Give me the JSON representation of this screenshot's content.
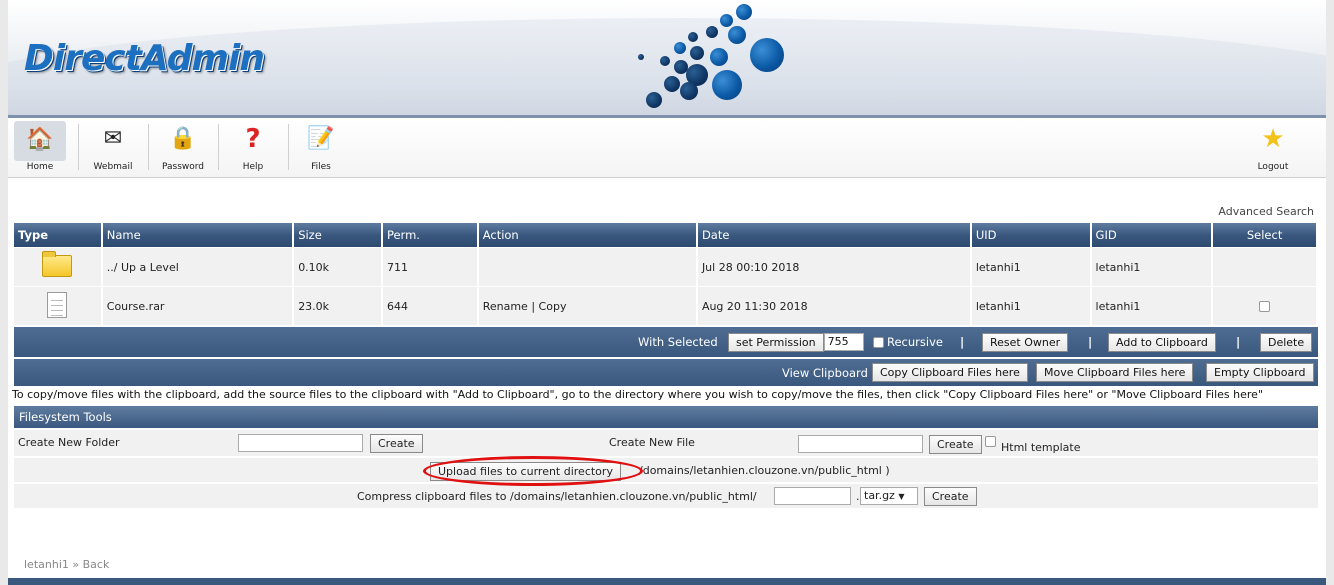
{
  "brand": {
    "logo_text": "DirectAdmin"
  },
  "toolbar": {
    "items": [
      {
        "label": "Home",
        "icon": "home-icon"
      },
      {
        "label": "Webmail",
        "icon": "mail-icon"
      },
      {
        "label": "Password",
        "icon": "lock-icon"
      },
      {
        "label": "Help",
        "icon": "help-icon"
      },
      {
        "label": "Files",
        "icon": "files-icon"
      },
      {
        "label": "Logout",
        "icon": "star-icon"
      }
    ]
  },
  "advanced_search": "Advanced Search",
  "table": {
    "columns": [
      "Type",
      "Name",
      "Size",
      "Perm.",
      "Action",
      "Date",
      "UID",
      "GID",
      "Select"
    ],
    "rows": [
      {
        "type": "folder-icon",
        "name": "../ Up a Level",
        "size": "0.10k",
        "perm": "711",
        "action": "",
        "date": "Jul 28 00:10 2018",
        "uid": "letanhi1",
        "gid": "letanhi1"
      },
      {
        "type": "file-icon",
        "name": "Course.rar",
        "size": "23.0k",
        "perm": "644",
        "action_rename": "Rename",
        "action_sep": "|",
        "action_copy": "Copy",
        "date": "Aug 20 11:30 2018",
        "uid": "letanhi1",
        "gid": "letanhi1"
      }
    ]
  },
  "with_selected": {
    "label": "With Selected",
    "set_permission": "set Permission",
    "permission_value": "755",
    "recursive": "Recursive",
    "reset_owner": "Reset Owner",
    "add_to_clipboard": "Add to Clipboard",
    "delete": "Delete",
    "separator": "|"
  },
  "clipboard": {
    "label": "View Clipboard",
    "copy_here": "Copy Clipboard Files here",
    "move_here": "Move Clipboard Files here",
    "empty": "Empty Clipboard"
  },
  "hint": "To copy/move files with the clipboard, add the source files to the clipboard with \"Add to Clipboard\", go to the directory where you wish to copy/move the files, then click \"Copy Clipboard Files here\" or \"Move Clipboard Files here\"",
  "filesystem": {
    "title": "Filesystem Tools",
    "create_folder_label": "Create New Folder",
    "create_file_label": "Create New File",
    "create_button": "Create",
    "html_template": "Html template",
    "upload_button": "Upload files to current directory",
    "upload_path": "/domains/letanhien.clouzone.vn/public_html )",
    "compress_label": "Compress clipboard files to /domains/letanhien.clouzone.vn/public_html/",
    "compress_dot": ".",
    "compress_ext": "tar.gz"
  },
  "footer": {
    "user": "letanhi1",
    "sep": "»",
    "back": "Back"
  }
}
